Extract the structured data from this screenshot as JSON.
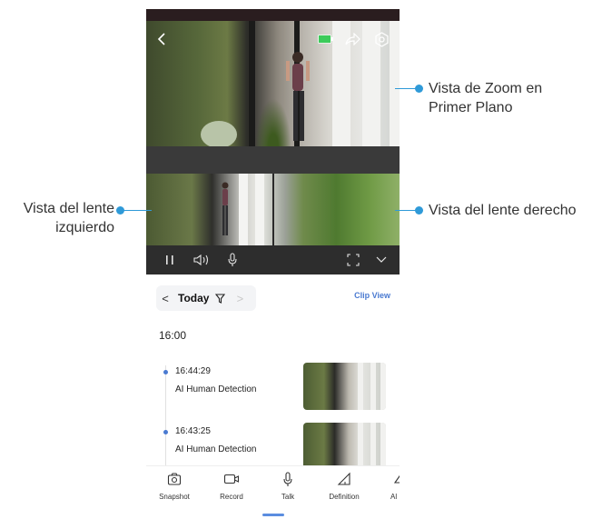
{
  "callouts": {
    "zoom_view_line1": "Vista de Zoom en",
    "zoom_view_line2": "Primer Plano",
    "left_lens_line1": "Vista del lente",
    "left_lens_line2": "izquierdo",
    "right_lens": "Vista del lente derecho"
  },
  "date_nav": {
    "prev": "<",
    "date": "Today",
    "next": ">"
  },
  "clip_view_label": "Clip View",
  "hour_label": "16:00",
  "events": [
    {
      "time": "16:44:29",
      "label": "AI Human Detection"
    },
    {
      "time": "16:43:25",
      "label": "AI Human Detection"
    }
  ],
  "tabs": [
    {
      "label": "Snapshot"
    },
    {
      "label": "Record"
    },
    {
      "label": "Talk"
    },
    {
      "label": "Definition"
    },
    {
      "label": "Al"
    }
  ],
  "colors": {
    "accent": "#4a7ad1",
    "callout": "#2f9ad8",
    "battery": "#3ccb5a"
  },
  "icons": [
    "back-icon",
    "battery-icon",
    "share-icon",
    "settings-icon",
    "pause-icon",
    "volume-icon",
    "mic-icon",
    "fullscreen-icon",
    "chevron-down-icon",
    "filter-icon",
    "camera-icon",
    "record-icon",
    "talk-icon",
    "definition-icon",
    "alarm-icon"
  ]
}
